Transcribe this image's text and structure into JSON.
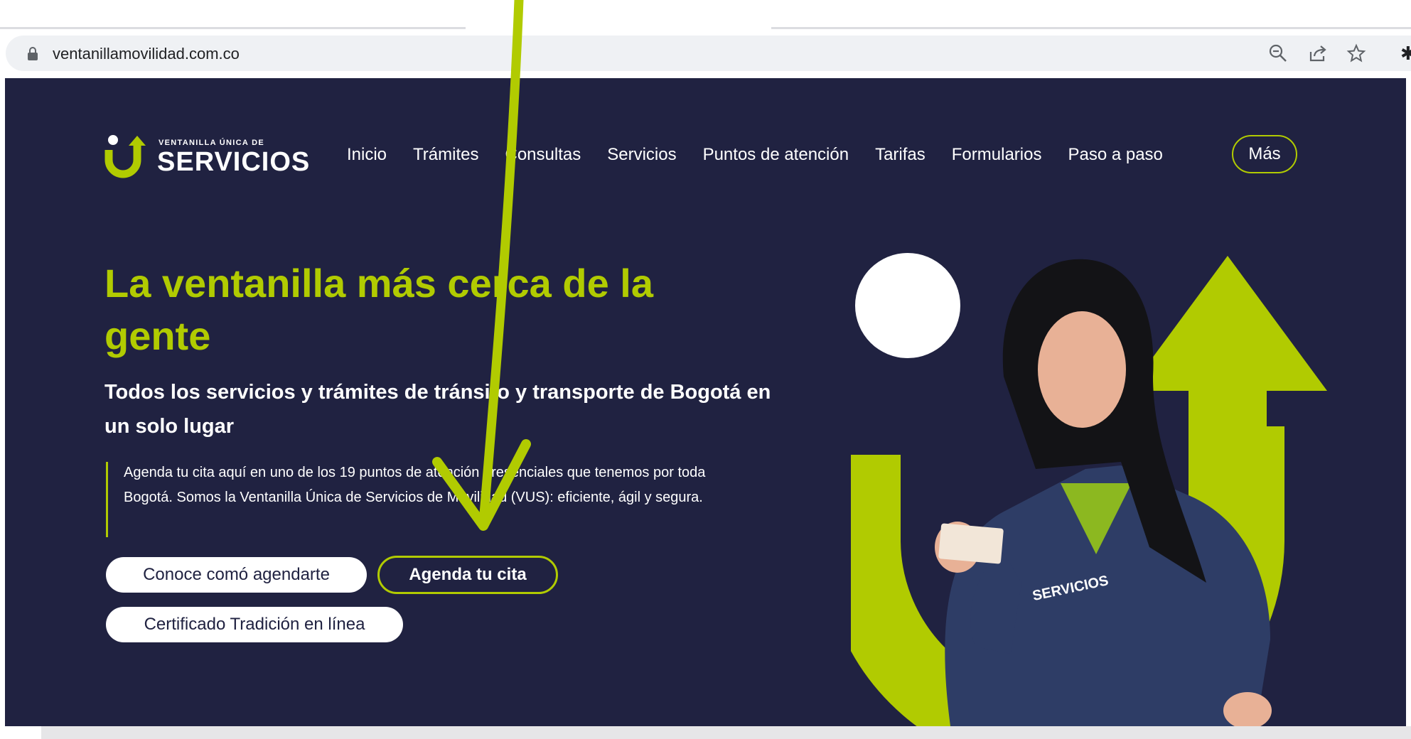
{
  "browser": {
    "url": "ventanillamovilidad.com.co",
    "icons": [
      "lock-icon",
      "zoom-out-icon",
      "share-icon",
      "star-icon",
      "extensions-icon"
    ]
  },
  "header": {
    "logo": {
      "line1": "VENTANILLA ÚNICA DE",
      "line2": "SERVICIOS"
    },
    "nav": [
      "Inicio",
      "Trámites",
      "Consultas",
      "Servicios",
      "Puntos de atención",
      "Tarifas",
      "Formularios",
      "Paso a paso"
    ],
    "more_label": "Más"
  },
  "hero": {
    "title": "La ventanilla más cerca de la gente",
    "subtitle": "Todos los servicios y trámites de tránsito y transporte de Bogotá en un solo lugar",
    "description": "Agenda tu cita aquí en uno de los 19 puntos de atención presenciales que tenemos por toda Bogotá. Somos la Ventanilla Única de Servicios de Movilidad (VUS): eficiente, ágil y segura.",
    "buttons": {
      "how_to": "Conoce comó agendarte",
      "book": "Agenda tu cita",
      "certificate": "Certificado Tradición en línea"
    },
    "jacket_text": "SERVICIOS"
  },
  "colors": {
    "accent": "#b1cb01",
    "background": "#202241",
    "text": "#ffffff"
  }
}
